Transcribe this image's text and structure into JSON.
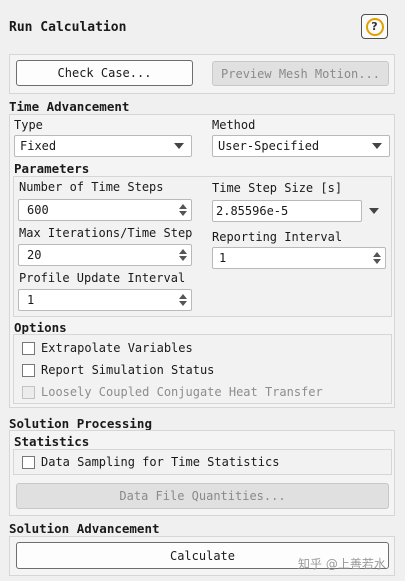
{
  "window_title": "Run Calculation",
  "help_label": "?",
  "toolbar": {
    "check_case": "Check Case...",
    "preview_mesh": "Preview Mesh Motion..."
  },
  "time_advancement": {
    "title": "Time Advancement",
    "type_label": "Type",
    "type_value": "Fixed",
    "method_label": "Method",
    "method_value": "User-Specified"
  },
  "parameters": {
    "title": "Parameters",
    "num_steps_label": "Number of Time Steps",
    "num_steps_value": "600",
    "step_size_label": "Time Step Size [s]",
    "step_size_value": "2.85596e-5",
    "max_iter_label": "Max Iterations/Time Step",
    "max_iter_value": "20",
    "reporting_label": "Reporting Interval",
    "reporting_value": "1",
    "profile_label": "Profile Update Interval",
    "profile_value": "1"
  },
  "options": {
    "title": "Options",
    "items": [
      {
        "label": "Extrapolate Variables",
        "checked": false,
        "enabled": true
      },
      {
        "label": "Report Simulation Status",
        "checked": false,
        "enabled": true
      },
      {
        "label": "Loosely Coupled Conjugate Heat Transfer",
        "checked": false,
        "enabled": false
      }
    ]
  },
  "solution_processing": {
    "title": "Solution Processing",
    "statistics_title": "Statistics",
    "sampling_label": "Data Sampling for Time Statistics",
    "data_file_button": "Data File Quantities..."
  },
  "solution_advancement": {
    "title": "Solution Advancement",
    "calculate_button": "Calculate"
  },
  "watermark": "知乎 @上善若水"
}
